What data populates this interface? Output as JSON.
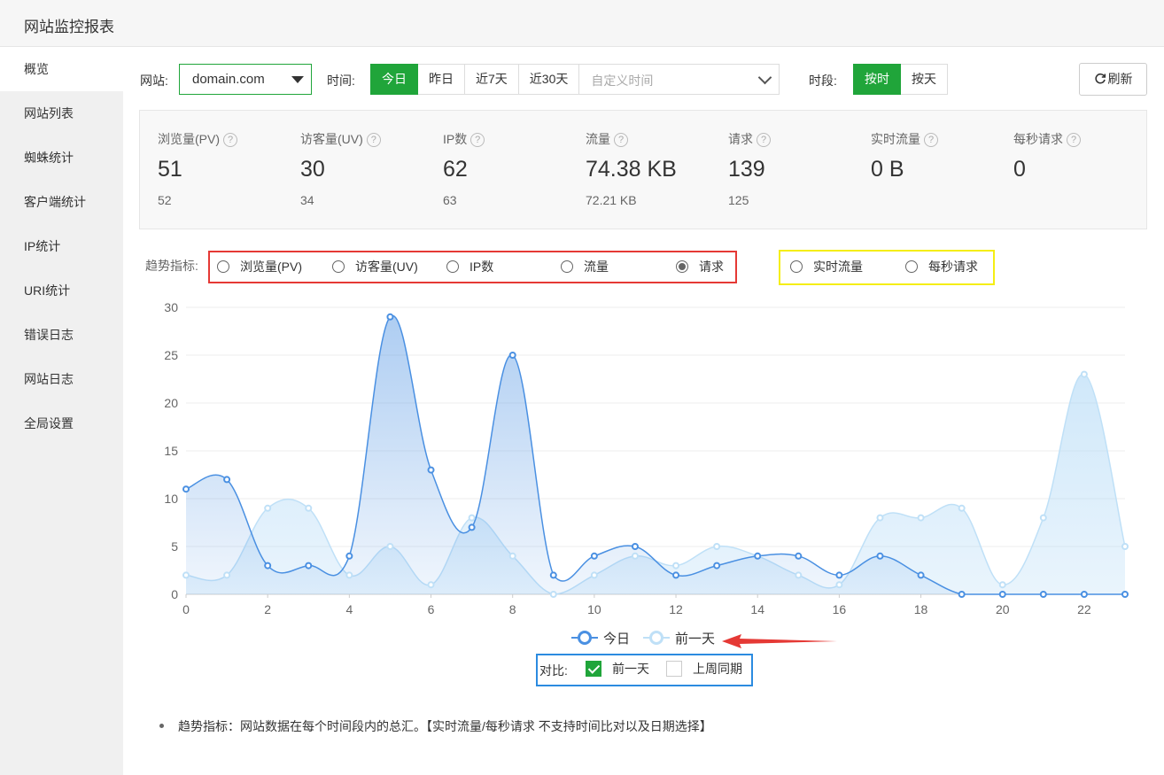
{
  "window": {
    "title": "网站监控报表"
  },
  "sidebar": {
    "items": [
      {
        "label": "概览",
        "active": true
      },
      {
        "label": "网站列表"
      },
      {
        "label": "蜘蛛统计"
      },
      {
        "label": "客户端统计"
      },
      {
        "label": "IP统计"
      },
      {
        "label": "URI统计"
      },
      {
        "label": "错误日志"
      },
      {
        "label": "网站日志"
      },
      {
        "label": "全局设置"
      }
    ]
  },
  "toolbar": {
    "site_label": "网站:",
    "site_value": "domain.com",
    "time_label": "时间:",
    "time_buttons": [
      "今日",
      "昨日",
      "近7天",
      "近30天"
    ],
    "time_active": "今日",
    "custom_time_placeholder": "自定义时间",
    "period_label": "时段:",
    "period_buttons": [
      "按时",
      "按天"
    ],
    "period_active": "按时",
    "refresh_label": "刷新"
  },
  "stats": [
    {
      "label": "浏览量(PV)",
      "value": "51",
      "prev": "52"
    },
    {
      "label": "访客量(UV)",
      "value": "30",
      "prev": "34"
    },
    {
      "label": "IP数",
      "value": "62",
      "prev": "63"
    },
    {
      "label": "流量",
      "value": "74.38 KB",
      "prev": "72.21 KB"
    },
    {
      "label": "请求",
      "value": "139",
      "prev": "125"
    },
    {
      "label": "实时流量",
      "value": "0 B",
      "prev": ""
    },
    {
      "label": "每秒请求",
      "value": "0",
      "prev": ""
    }
  ],
  "trend": {
    "label": "趋势指标:",
    "options": [
      "浏览量(PV)",
      "访客量(UV)",
      "IP数",
      "流量",
      "请求"
    ],
    "realtime_options": [
      "实时流量",
      "每秒请求"
    ],
    "selected": "请求"
  },
  "chart_data": {
    "type": "area",
    "x": [
      0,
      1,
      2,
      3,
      4,
      5,
      6,
      7,
      8,
      9,
      10,
      11,
      12,
      13,
      14,
      15,
      16,
      17,
      18,
      19,
      20,
      21,
      22,
      23
    ],
    "xticks": [
      0,
      2,
      4,
      6,
      8,
      10,
      12,
      14,
      16,
      18,
      20,
      22
    ],
    "yticks": [
      0,
      5,
      10,
      15,
      20,
      25,
      30
    ],
    "ylim": [
      0,
      30
    ],
    "series": [
      {
        "name": "今日",
        "color": "#4a90e2",
        "values": [
          11,
          12,
          3,
          3,
          4,
          29,
          13,
          7,
          25,
          2,
          4,
          5,
          2,
          3,
          4,
          4,
          2,
          4,
          2,
          0,
          0,
          0,
          0,
          0
        ]
      },
      {
        "name": "前一天",
        "color": "#bfe0f7",
        "values": [
          2,
          2,
          9,
          9,
          2,
          5,
          1,
          8,
          4,
          0,
          2,
          4,
          3,
          5,
          4,
          2,
          1,
          8,
          8,
          9,
          1,
          8,
          23,
          5
        ]
      }
    ],
    "grid": true,
    "legend_position": "bottom"
  },
  "compare": {
    "label": "对比:",
    "options": [
      {
        "label": "前一天",
        "checked": true
      },
      {
        "label": "上周同期",
        "checked": false
      }
    ]
  },
  "note": "趋势指标：网站数据在每个时间段内的总汇。【实时流量/每秒请求 不支持时间比对以及日期选择】",
  "colors": {
    "accent": "#20a53a",
    "today": "#4a90e2",
    "yesterday": "#bfe0f7",
    "annotation_red": "#e53935",
    "annotation_yellow": "#f5ee14",
    "annotation_blue": "#2b8be0"
  }
}
